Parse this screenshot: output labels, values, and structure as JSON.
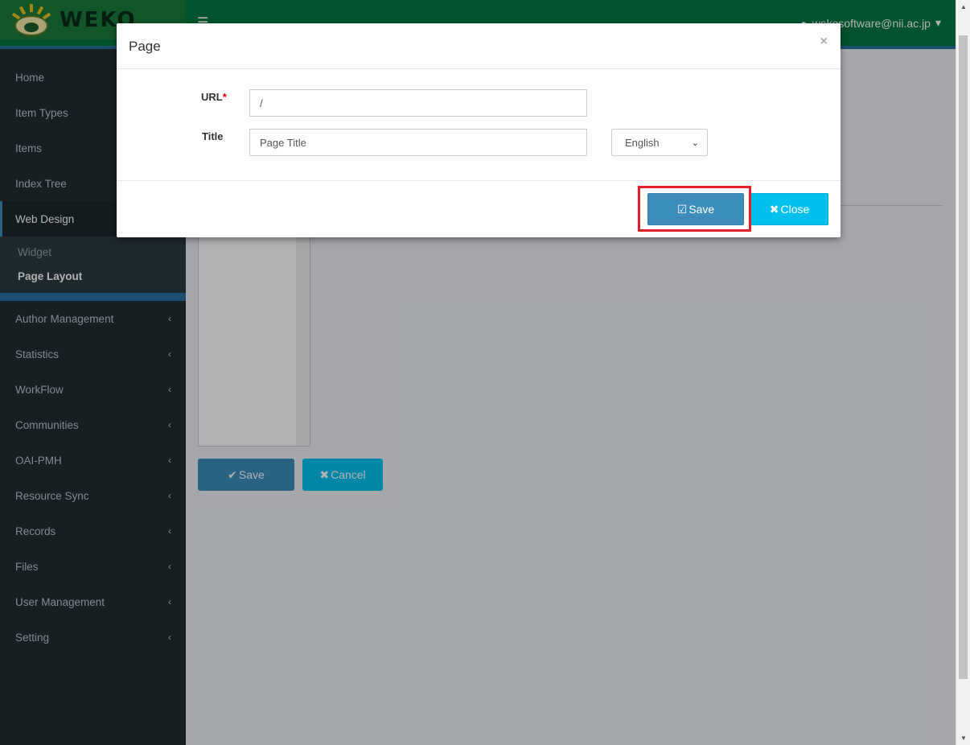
{
  "app": {
    "logo_text": "WEKO"
  },
  "header": {
    "menu_icon": "hamburger-icon",
    "user_email": "wekosoftware@nii.ac.jp"
  },
  "sidebar": {
    "items": [
      {
        "label": "Home"
      },
      {
        "label": "Item Types"
      },
      {
        "label": "Items"
      },
      {
        "label": "Index Tree"
      },
      {
        "label": "Web Design"
      },
      {
        "label": "Author Management"
      },
      {
        "label": "Statistics"
      },
      {
        "label": "WorkFlow"
      },
      {
        "label": "Communities"
      },
      {
        "label": "OAI-PMH"
      },
      {
        "label": "Resource Sync"
      },
      {
        "label": "Records"
      },
      {
        "label": "Files"
      },
      {
        "label": "User Management"
      },
      {
        "label": "Setting"
      }
    ],
    "submenu": [
      {
        "label": "Widget"
      },
      {
        "label": "Page Layout"
      }
    ]
  },
  "background_form": {
    "save_label": "Save",
    "cancel_label": "Cancel"
  },
  "modal": {
    "title": "Page",
    "close_glyph": "×",
    "url_label": "URL",
    "required_mark": "*",
    "url_value": "/",
    "title_label": "Title",
    "title_placeholder": "Page Title",
    "language_selected": "English",
    "save_label": "Save",
    "close_label": "Close"
  },
  "colors": {
    "header": "#00783f",
    "sidebar": "#222d32",
    "primary": "#3c8dbc",
    "info": "#00c0ef",
    "highlight": "#e01f26"
  }
}
